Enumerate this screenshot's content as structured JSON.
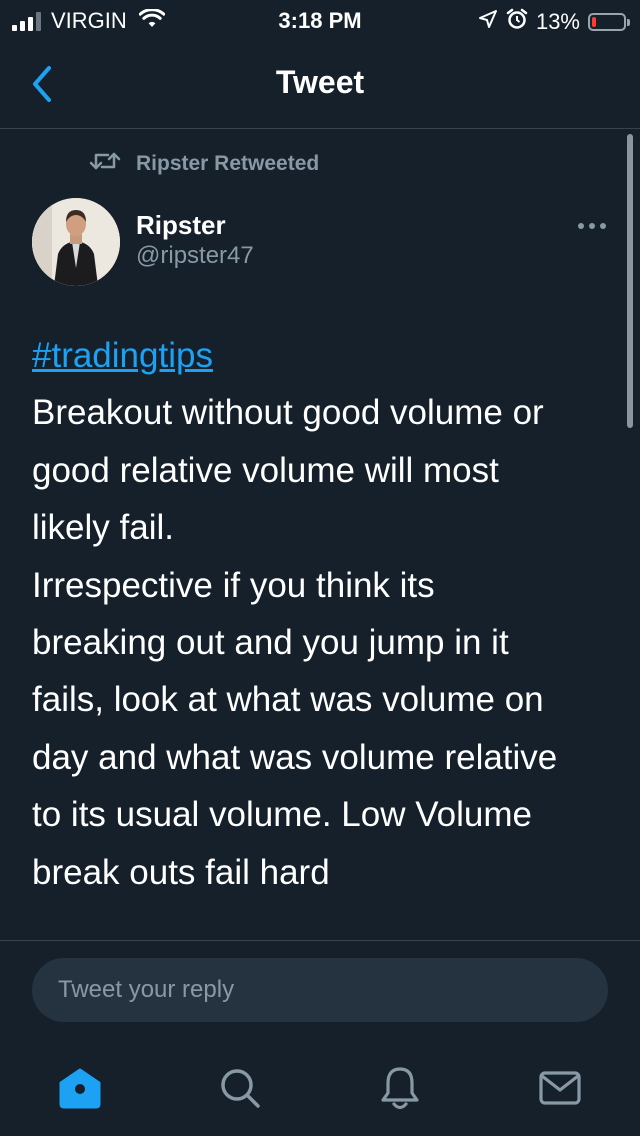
{
  "status_bar": {
    "carrier": "VIRGIN",
    "time": "3:18 PM",
    "battery_percent": "13%",
    "battery_level": 0.13,
    "battery_color": "#ff3b30"
  },
  "nav": {
    "title": "Tweet",
    "back_icon": "chevron-left-icon"
  },
  "tweet": {
    "retweet_label": "Ripster Retweeted",
    "author_name": "Ripster",
    "author_handle": "@ripster47",
    "hashtag": "#tradingtips",
    "body_lines": [
      "Breakout without good volume or",
      "good relative volume will most",
      "likely fail.",
      "Irrespective if you think its",
      "breaking out and you jump in it",
      "fails, look at what was volume on",
      "day and what was volume relative",
      "to its usual volume. Low Volume",
      "break outs fail hard"
    ]
  },
  "reply": {
    "placeholder": "Tweet your reply"
  },
  "tab_bar": {
    "items": [
      "home-icon",
      "search-icon",
      "notifications-icon",
      "messages-icon"
    ],
    "active": "home-icon"
  },
  "colors": {
    "background": "#15202b",
    "accent": "#1da1f2",
    "secondary_text": "#8899a6",
    "divider": "#38444d"
  }
}
